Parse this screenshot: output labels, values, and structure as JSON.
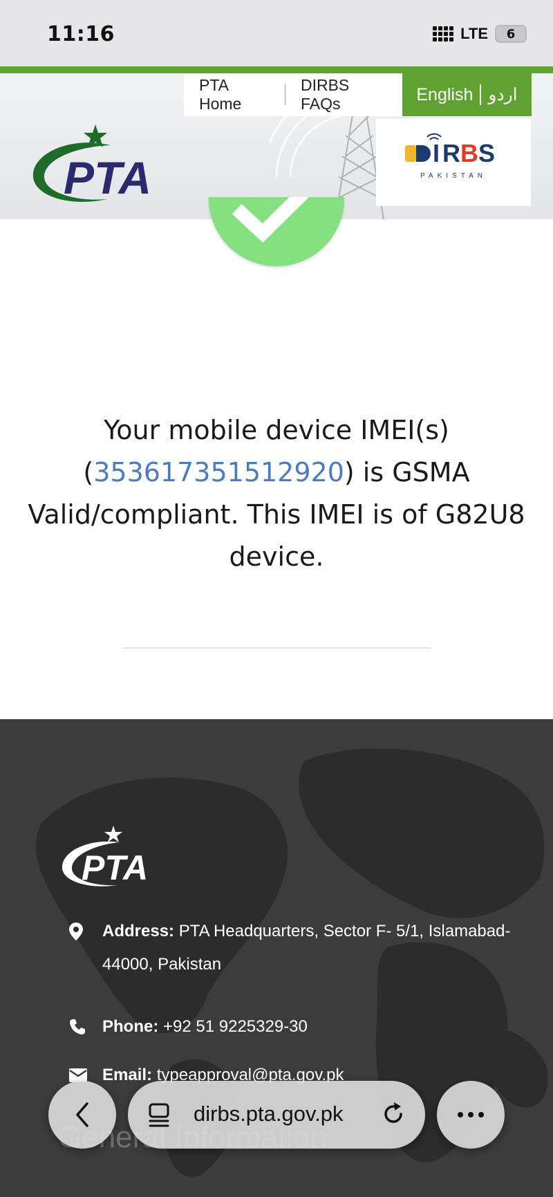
{
  "status_bar": {
    "time": "11:16",
    "network": "LTE",
    "battery": "6"
  },
  "header": {
    "nav": {
      "home": "PTA Home",
      "faqs": "DIRBS FAQs",
      "lang_en": "English",
      "lang_ur": "اردو"
    },
    "logo_text": "PTA",
    "dirbs_logo": {
      "text": "DIRBS",
      "sub": "PAKISTAN"
    },
    "colors": {
      "brand_green": "#5fa232",
      "pta_navy": "#2a2a6e",
      "pta_green": "#1e6b2a"
    }
  },
  "result": {
    "icon": "check-icon",
    "message_before": "Your mobile device IMEI(s) (",
    "imei": "353617351512920",
    "message_after": ") is GSMA Valid/compliant. This IMEI is of G82U8 device.",
    "colors": {
      "check_circle": "#85e080",
      "imei_link": "#4a7bc4"
    }
  },
  "footer": {
    "logo_text": "PTA",
    "address_label": "Address:",
    "address_value": "PTA Headquarters, Sector F- 5/1, Islamabad-44000, Pakistan",
    "phone_label": "Phone:",
    "phone_value": "+92 51 9225329-30",
    "email_label": "Email:",
    "email_value": "typeapproval@pta.gov.pk",
    "section_heading": "General Information"
  },
  "browser": {
    "url": "dirbs.pta.gov.pk",
    "icons": [
      "back-icon",
      "reader-icon",
      "reload-icon",
      "more-icon"
    ]
  }
}
